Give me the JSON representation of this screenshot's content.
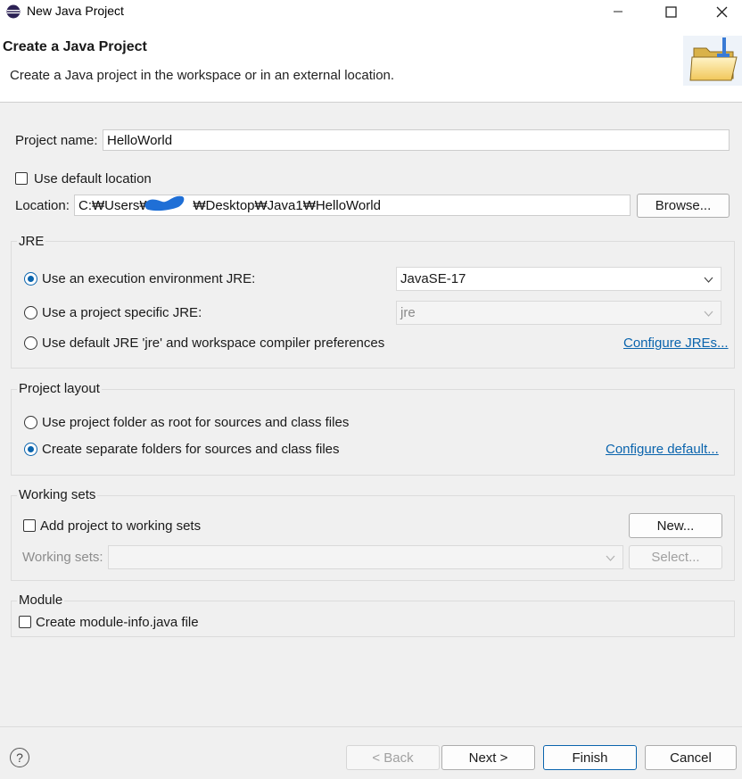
{
  "window": {
    "title": "New Java Project",
    "controls": {
      "minimize": "—",
      "maximize": "☐",
      "close": "✕"
    }
  },
  "banner": {
    "title": "Create a Java Project",
    "description": "Create a Java project in the workspace or in an external location."
  },
  "project": {
    "name_label": "Project name:",
    "name_value": "HelloWorld",
    "use_default_location_label": "Use default location",
    "use_default_location_checked": false,
    "location_label": "Location:",
    "location_value": "C:₩Users₩           ₩Desktop₩Java1₩HelloWorld",
    "browse_button": "Browse..."
  },
  "jre": {
    "group_title": "JRE",
    "options": [
      {
        "label": "Use an execution environment JRE:",
        "checked": true
      },
      {
        "label": "Use a project specific JRE:",
        "checked": false
      },
      {
        "label": "Use default JRE 'jre' and workspace compiler preferences",
        "checked": false
      }
    ],
    "execution_env_value": "JavaSE-17",
    "project_jre_value": "jre",
    "configure_link": "Configure JREs..."
  },
  "layout": {
    "group_title": "Project layout",
    "options": [
      {
        "label": "Use project folder as root for sources and class files",
        "checked": false
      },
      {
        "label": "Create separate folders for sources and class files",
        "checked": true
      }
    ],
    "configure_link": "Configure default..."
  },
  "working_sets": {
    "group_title": "Working sets",
    "add_label": "Add project to working sets",
    "add_checked": false,
    "new_button": "New...",
    "sets_label": "Working sets:",
    "sets_value": "",
    "select_button": "Select..."
  },
  "module": {
    "group_title": "Module",
    "create_label": "Create module-info.java file",
    "create_checked": false
  },
  "footer": {
    "help": "?",
    "back_button": "< Back",
    "next_button": "Next >",
    "finish_button": "Finish",
    "cancel_button": "Cancel"
  },
  "colors": {
    "accent": "#0a64ad",
    "background": "#f0f0f0",
    "redaction": "#1f6fd6"
  }
}
